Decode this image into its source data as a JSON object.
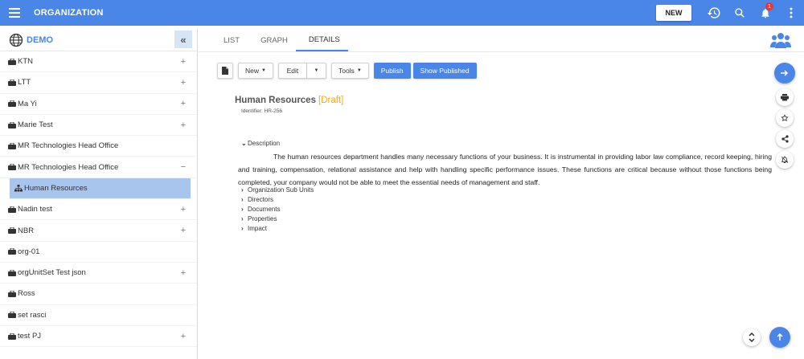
{
  "app": {
    "title": "ORGANIZATION",
    "new_label": "NEW",
    "notification_count": "1",
    "accent": "#4a86e8"
  },
  "sidebar": {
    "header": "DEMO",
    "items": [
      {
        "label": "KTN",
        "expander": "+"
      },
      {
        "label": "LTT",
        "expander": "+"
      },
      {
        "label": "Ma Yi",
        "expander": "+"
      },
      {
        "label": "Marie Test",
        "expander": "+"
      },
      {
        "label": "MR Technologies Head Office",
        "expander": ""
      },
      {
        "label": "MR Technologies Head Office",
        "expander": "−"
      },
      {
        "label": "Human Resources",
        "expander": "",
        "active": true
      },
      {
        "label": "Nadin test",
        "expander": "+"
      },
      {
        "label": "NBR",
        "expander": "+"
      },
      {
        "label": "org-01",
        "expander": ""
      },
      {
        "label": "orgUnitSet Test json",
        "expander": "+"
      },
      {
        "label": "Ross",
        "expander": ""
      },
      {
        "label": "set rasci",
        "expander": ""
      },
      {
        "label": "test PJ",
        "expander": "+"
      }
    ]
  },
  "tabs": [
    {
      "label": "LIST"
    },
    {
      "label": "GRAPH"
    },
    {
      "label": "DETAILS",
      "active": true
    }
  ],
  "toolbar": {
    "new": "New",
    "edit": "Edit",
    "tools": "Tools",
    "publish": "Publish",
    "show_published": "Show Published"
  },
  "detail": {
    "title": "Human Resources",
    "status": "[Draft]",
    "identifier": "Identifier:  HR-256",
    "description_label": "Description",
    "description_text": "The human resources department handles many necessary functions of your business. It is instrumental in providing labor law compliance, record keeping, hiring and training, compensation, relational assistance and help with handling specific performance issues. These functions are critical because without those functions being completed, your company would not be able to meet the essential needs of management and staff.",
    "sections": [
      {
        "label": "Organization Sub Units"
      },
      {
        "label": "Directors"
      },
      {
        "label": "Documents"
      },
      {
        "label": "Properties"
      },
      {
        "label": "Impact"
      }
    ]
  }
}
